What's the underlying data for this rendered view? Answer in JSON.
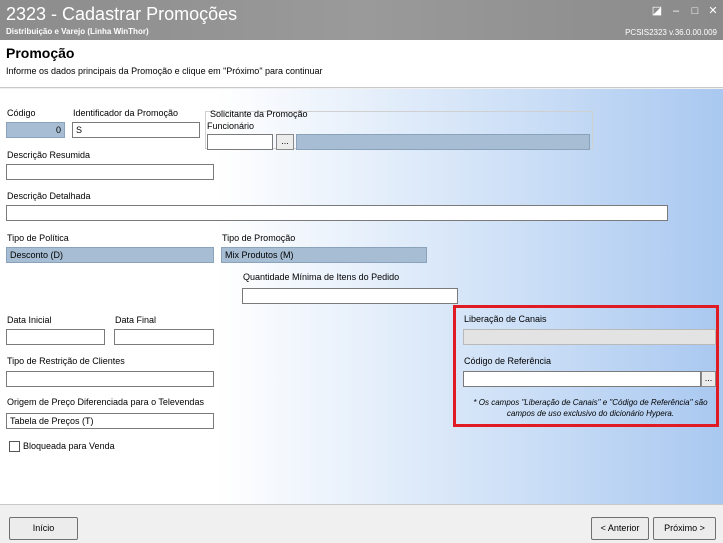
{
  "window": {
    "title": "2323 - Cadastrar Promoções",
    "subtitle": "Distribuição e Varejo (Linha WinThor)",
    "version": "PCSIS2323  v.36.0.00.009",
    "controls": [
      "restore-icon",
      "minimize-icon",
      "maximize-icon",
      "close-icon"
    ]
  },
  "header": {
    "title": "Promoção",
    "description": "Informe os dados principais da Promoção e clique em \"Próximo\" para continuar"
  },
  "form": {
    "codigo": {
      "label": "Código",
      "value": "0"
    },
    "identificador": {
      "label": "Identificador da Promoção",
      "value": "S"
    },
    "solicitante": {
      "label": "Solicitante da Promoção",
      "sublabel": "Funcionário",
      "value": "",
      "lookup_label": "...",
      "name_value": ""
    },
    "descricao_resumida": {
      "label": "Descrição Resumida",
      "value": ""
    },
    "descricao_detalhada": {
      "label": "Descrição Detalhada",
      "value": ""
    },
    "tipo_politica": {
      "label": "Tipo de Política",
      "value": "Desconto (D)"
    },
    "tipo_promocao": {
      "label": "Tipo de Promoção",
      "value": "Mix Produtos (M)"
    },
    "qtd_minima": {
      "label": "Quantidade Mínima de Itens do Pedido",
      "value": ""
    },
    "data_inicial": {
      "label": "Data Inicial",
      "value": ""
    },
    "data_final": {
      "label": "Data Final",
      "value": ""
    },
    "tipo_restricao": {
      "label": "Tipo de Restrição de Clientes",
      "value": ""
    },
    "origem_preco": {
      "label": "Origem de Preço Diferenciada para o Televendas",
      "value": "Tabela de Preços (T)"
    },
    "bloqueada": {
      "label": "Bloqueada para Venda",
      "checked": false
    },
    "liberacao_canais": {
      "label": "Liberação de Canais",
      "value": ""
    },
    "codigo_referencia": {
      "label": "Código de Referência",
      "value": "",
      "lookup_label": "..."
    },
    "note": "* Os campos \"Liberação de Canais\" e \"Código de Referência\" são campos de uso exclusivo do dicionário Hypera."
  },
  "footer": {
    "inicio_label": "Início",
    "anterior_label": "< Anterior",
    "proximo_label": "Próximo >"
  },
  "colors": {
    "highlight": "#e01b24",
    "readonly_field": "#a7bdd3",
    "titlebar": "#8f8f8f"
  }
}
